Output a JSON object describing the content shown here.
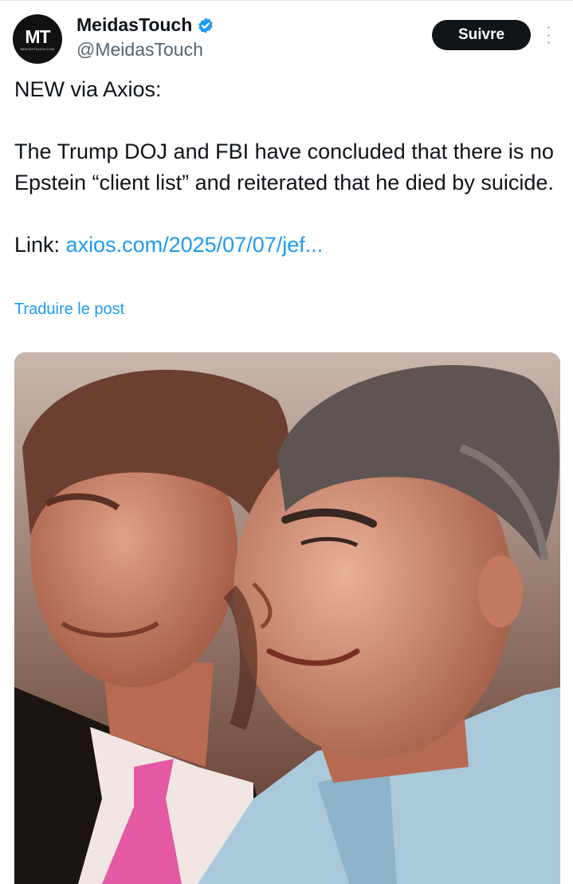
{
  "author": {
    "display_name": "MeidasTouch",
    "handle": "@MeidasTouch",
    "avatar_monogram": "MT",
    "avatar_subtext": "MEIDASTOUCH.COM",
    "verified_icon": "verified-badge-icon"
  },
  "actions": {
    "follow_label": "Suivre",
    "more_icon": "more-vertical-icon"
  },
  "tweet": {
    "line1": "NEW via Axios:",
    "line2": "The Trump DOJ and FBI have concluded that there is no Epstein “client list” and reiterated that he died by suicide.",
    "link_prefix": "Link: ",
    "link_text": "axios.com/2025/07/07/jef...",
    "translate_label": "Traduire le post"
  },
  "colors": {
    "link": "#1d9bf0",
    "button_bg": "#0f1419",
    "secondary_text": "#536471"
  }
}
